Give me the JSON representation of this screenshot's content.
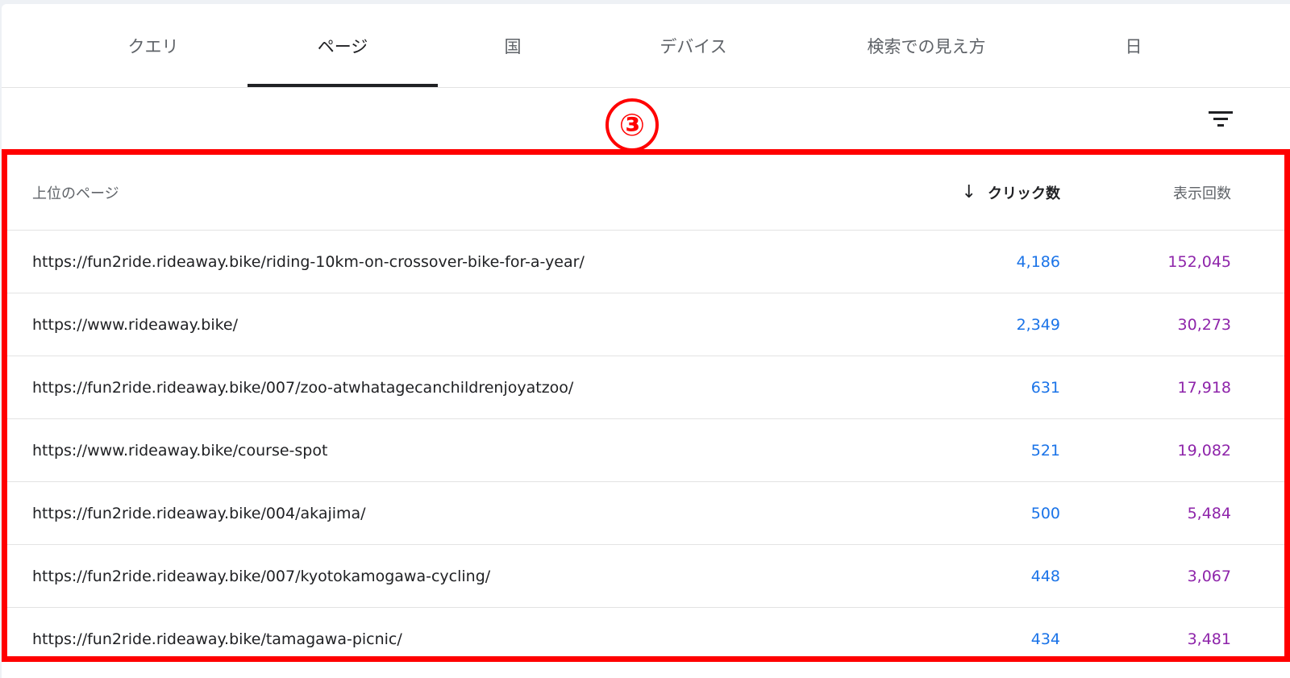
{
  "tabs": [
    {
      "label": "クエリ",
      "active": false
    },
    {
      "label": "ページ",
      "active": true
    },
    {
      "label": "国",
      "active": false
    },
    {
      "label": "デバイス",
      "active": false
    },
    {
      "label": "検索での見え方",
      "active": false
    },
    {
      "label": "日",
      "active": false
    }
  ],
  "annotation": {
    "label": "③"
  },
  "icons": {
    "filter": "filter-icon",
    "sort": "arrow-down-icon"
  },
  "colors": {
    "clicks": "#1a73e8",
    "impressions": "#8e24aa",
    "highlight": "#ff0000"
  },
  "table": {
    "headers": {
      "page": "上位のページ",
      "sort_arrow": "↓",
      "clicks": "クリック数",
      "impressions": "表示回数"
    },
    "rows": [
      {
        "url": "https://fun2ride.rideaway.bike/riding-10km-on-crossover-bike-for-a-year/",
        "clicks": "4,186",
        "impressions": "152,045"
      },
      {
        "url": "https://www.rideaway.bike/",
        "clicks": "2,349",
        "impressions": "30,273"
      },
      {
        "url": "https://fun2ride.rideaway.bike/007/zoo-atwhatagecanchildrenjoyatzoo/",
        "clicks": "631",
        "impressions": "17,918"
      },
      {
        "url": "https://www.rideaway.bike/course-spot",
        "clicks": "521",
        "impressions": "19,082"
      },
      {
        "url": "https://fun2ride.rideaway.bike/004/akajima/",
        "clicks": "500",
        "impressions": "5,484"
      },
      {
        "url": "https://fun2ride.rideaway.bike/007/kyotokamogawa-cycling/",
        "clicks": "448",
        "impressions": "3,067"
      },
      {
        "url": "https://fun2ride.rideaway.bike/tamagawa-picnic/",
        "clicks": "434",
        "impressions": "3,481"
      }
    ]
  }
}
